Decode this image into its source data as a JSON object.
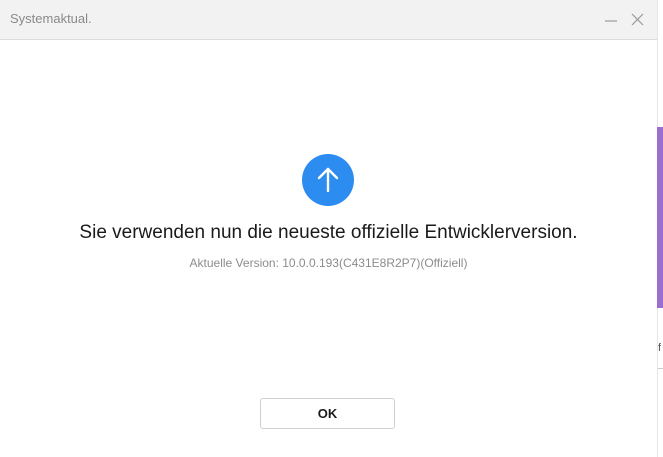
{
  "window": {
    "title": "Systemaktual.",
    "controls": {
      "minimize_icon": "minimize-icon",
      "close_icon": "close-icon"
    }
  },
  "dialog": {
    "icon": "arrow-up-icon",
    "icon_color": "#2d8cf0",
    "headline": "Sie verwenden nun die neueste offizielle Entwicklerversion.",
    "version_text": "Aktuelle Version: 10.0.0.193(C431E8R2P7)(Offiziell)",
    "ok_label": "OK"
  },
  "background_window": {
    "accent_color": "#9b6fd1",
    "partial_glyph": "f"
  }
}
